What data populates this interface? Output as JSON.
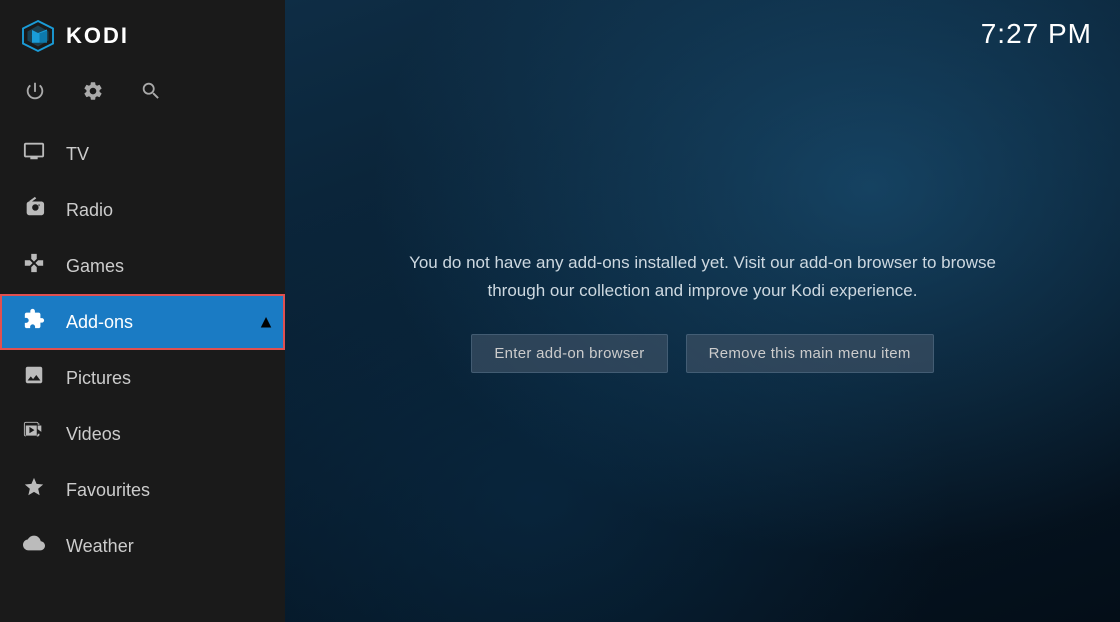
{
  "app": {
    "title": "KODI",
    "clock": "7:27 PM"
  },
  "sidebar": {
    "icons": [
      {
        "name": "power-icon",
        "symbol": "⏻",
        "label": "Power"
      },
      {
        "name": "settings-icon",
        "symbol": "⚙",
        "label": "Settings"
      },
      {
        "name": "search-icon",
        "symbol": "🔍",
        "label": "Search"
      }
    ],
    "nav_items": [
      {
        "id": "tv",
        "label": "TV",
        "icon": "tv-icon",
        "active": false
      },
      {
        "id": "radio",
        "label": "Radio",
        "icon": "radio-icon",
        "active": false
      },
      {
        "id": "games",
        "label": "Games",
        "icon": "games-icon",
        "active": false
      },
      {
        "id": "addons",
        "label": "Add-ons",
        "icon": "addons-icon",
        "active": true
      },
      {
        "id": "pictures",
        "label": "Pictures",
        "icon": "pictures-icon",
        "active": false
      },
      {
        "id": "videos",
        "label": "Videos",
        "icon": "videos-icon",
        "active": false
      },
      {
        "id": "favourites",
        "label": "Favourites",
        "icon": "favourites-icon",
        "active": false
      },
      {
        "id": "weather",
        "label": "Weather",
        "icon": "weather-icon",
        "active": false
      }
    ]
  },
  "main": {
    "message": "You do not have any add-ons installed yet. Visit our add-on browser to browse through our collection and improve your Kodi experience.",
    "buttons": [
      {
        "id": "enter-addon-browser",
        "label": "Enter add-on browser"
      },
      {
        "id": "remove-menu-item",
        "label": "Remove this main menu item"
      }
    ]
  }
}
